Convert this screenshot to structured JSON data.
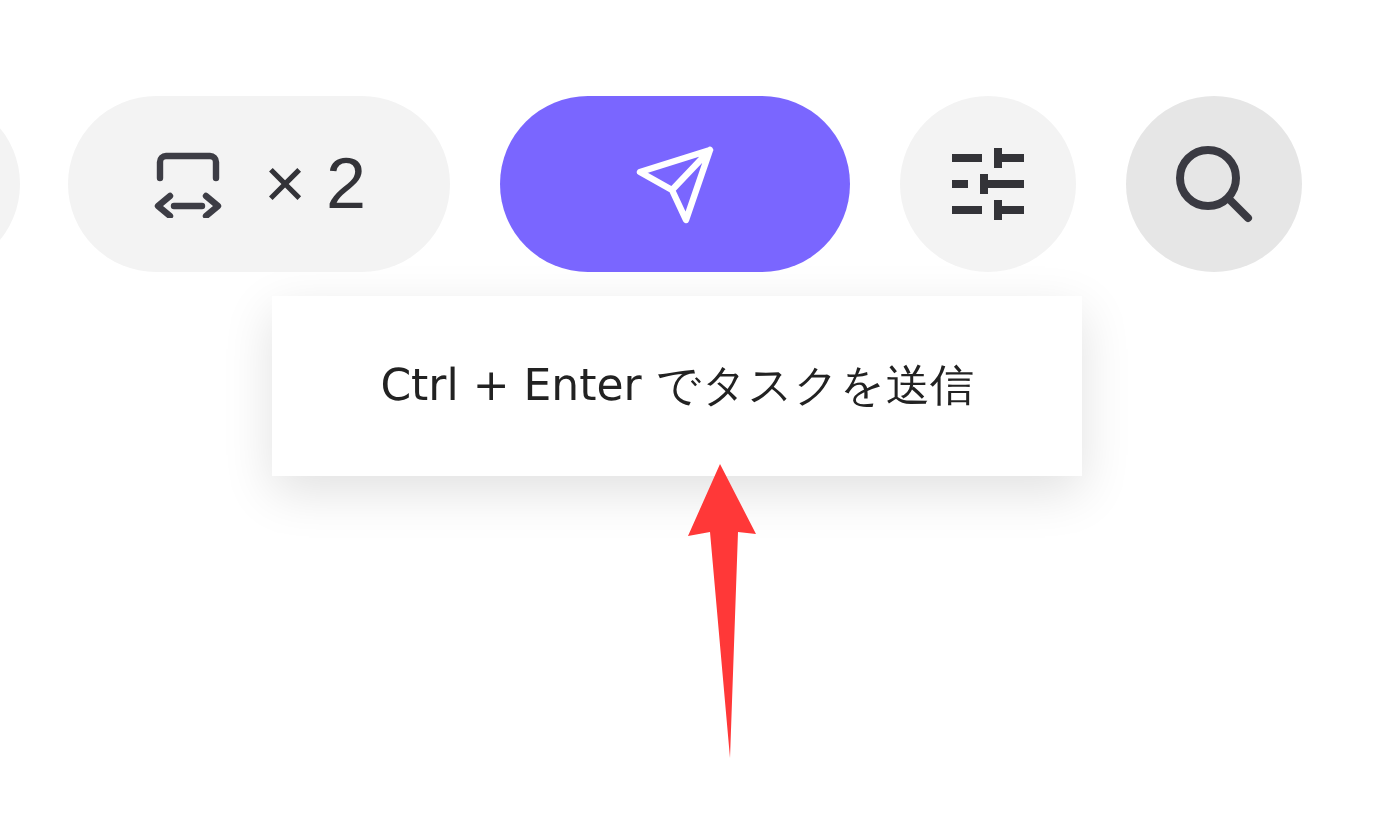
{
  "toolbar": {
    "buttons": [
      {
        "kind": "partial"
      },
      {
        "kind": "repeat",
        "label": "× 2"
      },
      {
        "kind": "send"
      },
      {
        "kind": "settings"
      },
      {
        "kind": "search"
      }
    ]
  },
  "tooltip": {
    "text": "Ctrl + Enter でタスクを送信"
  }
}
